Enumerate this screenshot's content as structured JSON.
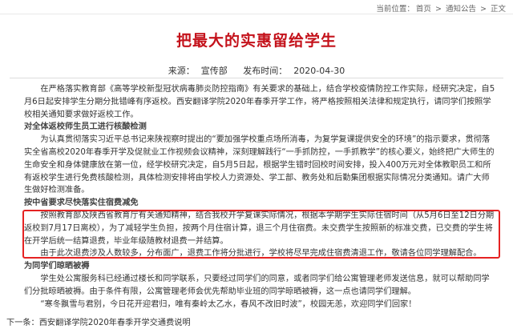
{
  "breadcrumb": {
    "prefix": "当前位置：",
    "items": [
      "首页",
      "通知公告",
      "正文"
    ],
    "separator": ">"
  },
  "article": {
    "title": "把最大的实惠留给学生",
    "source_label": "来源：",
    "source": "宣传部",
    "date_label": "发布时间：",
    "date": "2020-04-30",
    "paragraphs": [
      "在严格落实教育部《高等学校新型冠状病毒肺炎防控指南》有关要求的基础上，结合学校疫情防控工作实际，经研究决定，自5月6日起安排学生分期分批错峰有序返校。西安翻译学院2020年春季开学工作，将严格按照相关法律和规定执行，请同学们按照学校相关通知要求做好返校工作。",
      "对全体返校师生员工进行核酸检测",
      "为认真贯彻落实习近平总书记来陕视察时提出的“要加强学校重点场所消毒，为复学复课提供安全的环境”的指示要求，贯彻落实全省高校2020年春季开学及促就业工作视频会议精神，深刻理解践行“一手抓防控，一手抓教学”的核心要义，始终把广大师生的生命安全和身体健康放在第一位，经学校研究决定，自5月5日起，根据学生错时回校时间安排，投入400万元对全体教职员工和所有返校学生进行免费核酸检测，具体检测安排将由学校人力资源处、学工部、教务处和后勤集团根据实际情况分类通知。请广大师生做好检测准备。",
      "按中省要求尽快落实住宿费减免",
      "按照教育部及陕西省教育厅有关通知精神，结合我校开学复课实际情况，根据本学期学生实际住宿时间（从5月6日至12日分期返校到7月17日离校），为了减轻学生负担，按两个月住宿计算，退三个月住宿费。未交费学生按照新的标准交费，已交费的学生将在开学后统一结算退费，毕业年级随教材退费一并结算。",
      "由于此次退费涉及人数较多，分布面广，退费工作将分批进行，学校将尽早完成住宿费清退工作，敬请各位同学理解配合。",
      "为同学们晾晒被褥",
      "学生处公寓服务科已经通过楼长和同学联系，只要经过同学们的同意，或者同学们给公寓管理老师发送信息，就可以帮助同学们分批晾晒被褥。由于条件有限，公寓管理老师会优先帮助毕业班的同学晾晒被褥，这一点也请同学们理解。",
      "“寒冬飘雪与君别，今日花开迎君归，唯有秦岭太乙水，春风不改旧时波”，校园无恙，欢迎同学们回家！"
    ]
  },
  "next_link": {
    "label": "下一条：",
    "title": "西安翻译学院2020年春季开学交通费说明"
  }
}
